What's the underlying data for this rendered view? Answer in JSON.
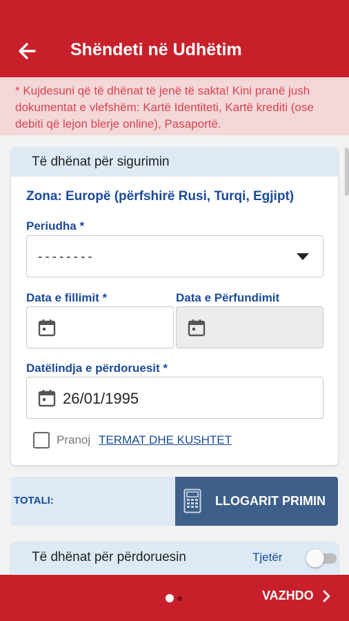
{
  "header": {
    "title": "Shëndeti në Udhëtim",
    "back_icon": "arrow-left-icon"
  },
  "notice": {
    "text": "* Kujdesuni që të dhënat të jenë të sakta! Kini pranë jush dokumentat e vlefshëm: Kartë Identiteti, Kartë krediti (ose debiti që lejon blerje online), Pasaportë."
  },
  "insurance_section": {
    "title": "Të dhënat për sigurimin",
    "zone": "Zona: Europë (përfshirë Rusi, Turqi, Egjipt)",
    "period_label": "Periudha *",
    "period_value": "--------",
    "start_date_label": "Data e fillimit *",
    "start_date_value": "",
    "end_date_label": "Data e Përfundimit",
    "end_date_value": "",
    "birthdate_label": "Datëlindja e përdoruesit *",
    "birthdate_value": "26/01/1995",
    "terms_prefix": "Pranoj",
    "terms_link": "TERMAT DHE KUSHTET",
    "terms_checked": false
  },
  "total": {
    "label": "TOTALI:",
    "value": "",
    "calc_button": "LLOGARIT PRIMIN",
    "calc_icon": "calculator-icon"
  },
  "user_section": {
    "title": "Të dhënat për përdoruesin",
    "other_label": "Tjetër",
    "other_toggle_on": false
  },
  "footer": {
    "next_label": "VAZHDO",
    "page_count": 2,
    "current_page": 1
  },
  "colors": {
    "primary": "#c8202a",
    "accent_blue": "#1a4a9a",
    "button_blue": "#3e5f89",
    "notice_bg": "#f3d7d9",
    "notice_text": "#d9434e",
    "section_header_bg": "#dde9f4"
  }
}
